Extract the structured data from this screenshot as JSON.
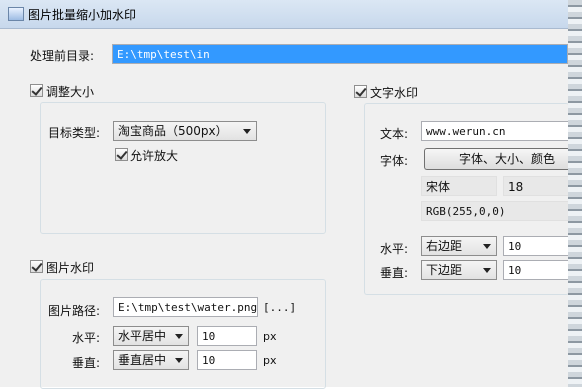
{
  "window": {
    "title": "图片批量缩小加水印"
  },
  "source": {
    "label": "处理前目录:",
    "value": "E:\\tmp\\test\\in"
  },
  "resize": {
    "enabled_label": "调整大小",
    "target_type_label": "目标类型:",
    "target_type_value": "淘宝商品（500px）",
    "allow_enlarge_label": "允许放大"
  },
  "image_watermark": {
    "enabled_label": "图片水印",
    "path_label": "图片路径:",
    "path_value": "E:\\tmp\\test\\water.png",
    "browse_label": "[...]",
    "horizontal_label": "水平:",
    "horizontal_value": "水平居中",
    "horizontal_offset": "10",
    "vertical_label": "垂直:",
    "vertical_value": "垂直居中",
    "vertical_offset": "10",
    "unit": "px"
  },
  "text_watermark": {
    "enabled_label": "文字水印",
    "text_label": "文本:",
    "text_value": "www.werun.cn",
    "font_label": "字体:",
    "font_button": "字体、大小、颜色",
    "font_name": "宋体",
    "font_size": "18",
    "font_color": "RGB(255,0,0)",
    "horizontal_label": "水平:",
    "horizontal_value": "右边距",
    "horizontal_offset": "10",
    "vertical_label": "垂直:",
    "vertical_value": "下边距",
    "vertical_offset": "10"
  }
}
